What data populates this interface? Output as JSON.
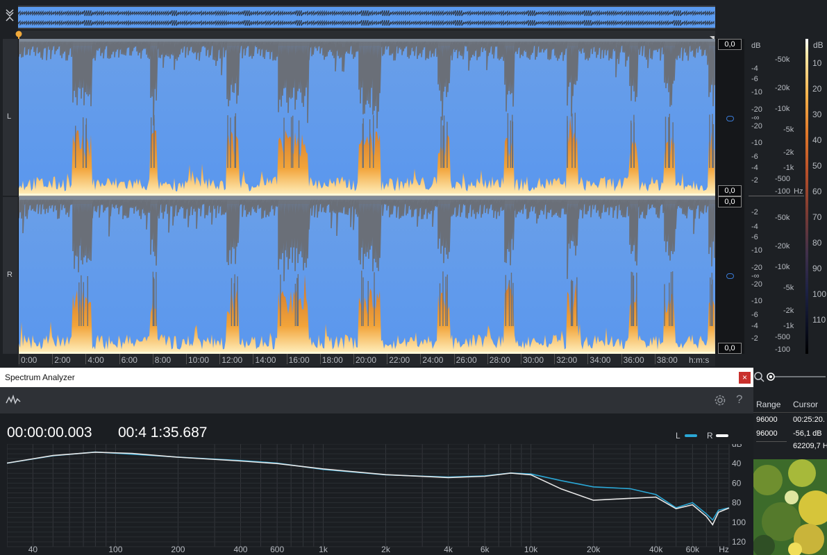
{
  "editor": {
    "channels": [
      {
        "label": "L"
      },
      {
        "label": "R"
      }
    ],
    "zoom_values": {
      "l_top": "0,0",
      "l_bottom": "0,0",
      "r_top": "0,0",
      "r_bottom": "0,0"
    },
    "waveform_db_scale_l": [
      "dB",
      "-4",
      "-6",
      "-10",
      "-20",
      "-∞",
      "-20",
      "-10",
      "-6",
      "-4",
      "-2"
    ],
    "waveform_db_scale_r": [
      "-2",
      "-4",
      "-6",
      "-10",
      "-20",
      "-∞",
      "-20",
      "-10",
      "-6",
      "-4",
      "-2"
    ],
    "freq_scale_l": [
      "-50k",
      "-20k",
      "-10k",
      "-5k",
      "-2k",
      "-1k",
      "-500",
      "-100"
    ],
    "freq_scale_r": [
      "-50k",
      "-20k",
      "-10k",
      "-5k",
      "-2k",
      "-1k",
      "-500",
      "-100"
    ],
    "freq_unit": "Hz",
    "colorbar": {
      "unit": "dB",
      "labels": [
        "10",
        "20",
        "30",
        "40",
        "50",
        "60",
        "70",
        "80",
        "90",
        "100",
        "110"
      ]
    },
    "time_ruler": {
      "ticks": [
        "0:00",
        "2:00",
        "4:00",
        "6:00",
        "8:00",
        "10:00",
        "12:00",
        "14:00",
        "16:00",
        "18:00",
        "20:00",
        "22:00",
        "24:00",
        "26:00",
        "28:00",
        "30:00",
        "32:00",
        "34:00",
        "36:00",
        "38:00"
      ],
      "unit": "h:m:s"
    }
  },
  "info_panel": {
    "headers": {
      "range": "Range",
      "cursor": "Cursor"
    },
    "range_values": [
      "96000",
      "96000"
    ],
    "cursor_values": [
      "00:25:20.",
      "-56,1 dB",
      "62209,7 H"
    ]
  },
  "spectrum_analyzer": {
    "title": "Spectrum Analyzer",
    "close_label": "×",
    "help_label": "?",
    "time_start": "00:00:00.003",
    "time_end": "00:4 1:35.687",
    "legend": [
      {
        "label": "L",
        "color": "#2aa7d6"
      },
      {
        "label": "R",
        "color": "#ffffff"
      }
    ],
    "chart_data": {
      "type": "line",
      "x_label_unit": "Hz",
      "y_label_unit": "dB",
      "x_ticks": [
        "40",
        "100",
        "200",
        "400",
        "600",
        "1k",
        "2k",
        "4k",
        "6k",
        "10k",
        "20k",
        "40k",
        "60k",
        "Hz"
      ],
      "y_ticks": [
        "dB",
        "40",
        "60",
        "80",
        "100",
        "120"
      ],
      "ylim": [
        20,
        125
      ],
      "xlim_hz": [
        30,
        90000
      ],
      "series": [
        {
          "name": "L",
          "color": "#2aa7d6",
          "points": [
            [
              30,
              40
            ],
            [
              50,
              32
            ],
            [
              80,
              28
            ],
            [
              120,
              30
            ],
            [
              200,
              33
            ],
            [
              400,
              37
            ],
            [
              600,
              40
            ],
            [
              1000,
              46
            ],
            [
              2000,
              51
            ],
            [
              4000,
              54
            ],
            [
              6000,
              53
            ],
            [
              8000,
              50
            ],
            [
              10000,
              51
            ],
            [
              14000,
              58
            ],
            [
              20000,
              64
            ],
            [
              30000,
              66
            ],
            [
              40000,
              72
            ],
            [
              50000,
              85
            ],
            [
              60000,
              80
            ],
            [
              70000,
              92
            ],
            [
              75000,
              98
            ],
            [
              80000,
              88
            ],
            [
              90000,
              85
            ]
          ]
        },
        {
          "name": "R",
          "color": "#e8e8e8",
          "points": [
            [
              30,
              40
            ],
            [
              50,
              32
            ],
            [
              80,
              28
            ],
            [
              120,
              30
            ],
            [
              200,
              33
            ],
            [
              400,
              37
            ],
            [
              600,
              40
            ],
            [
              1000,
              46
            ],
            [
              2000,
              51
            ],
            [
              4000,
              54
            ],
            [
              6000,
              53
            ],
            [
              8000,
              50
            ],
            [
              10000,
              52
            ],
            [
              14000,
              66
            ],
            [
              20000,
              78
            ],
            [
              30000,
              76
            ],
            [
              40000,
              74
            ],
            [
              50000,
              86
            ],
            [
              60000,
              82
            ],
            [
              70000,
              94
            ],
            [
              75000,
              102
            ],
            [
              80000,
              90
            ],
            [
              90000,
              86
            ]
          ]
        }
      ]
    }
  },
  "colors": {
    "spectrogram_bg": "#5b9bf0",
    "warm_low": "#f0a23a",
    "warm_high": "#ffe9b0",
    "wave_grey": "#6a6f78"
  }
}
